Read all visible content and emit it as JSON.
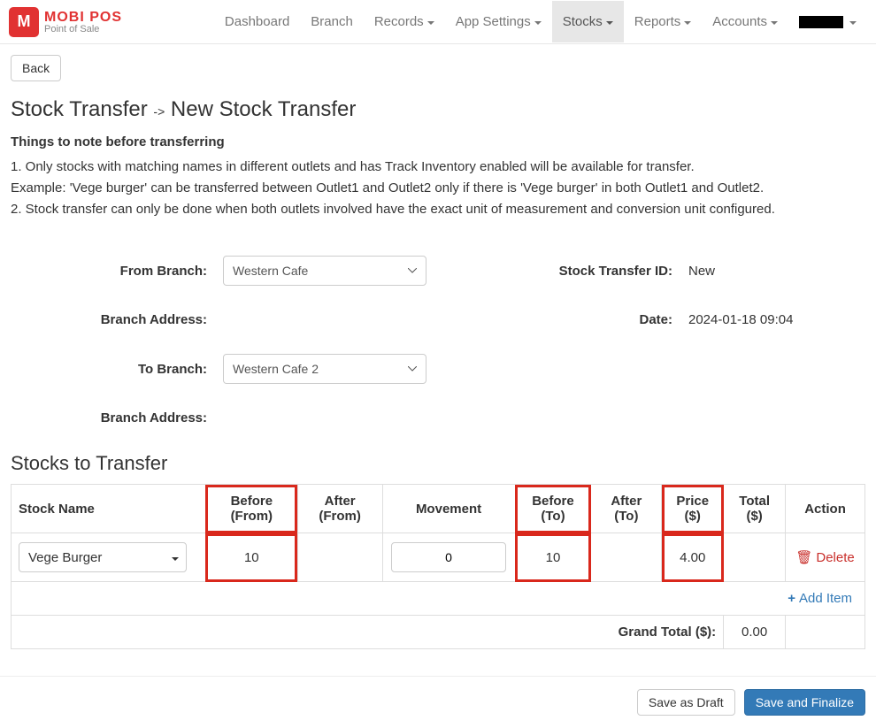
{
  "brand": {
    "name": "MOBI POS",
    "tagline": "Point of Sale",
    "logo_letter": "M"
  },
  "nav": {
    "items": [
      {
        "label": "Dashboard",
        "caret": false,
        "active": false
      },
      {
        "label": "Branch",
        "caret": false,
        "active": false
      },
      {
        "label": "Records",
        "caret": true,
        "active": false
      },
      {
        "label": "App Settings",
        "caret": true,
        "active": false
      },
      {
        "label": "Stocks",
        "caret": true,
        "active": true
      },
      {
        "label": "Reports",
        "caret": true,
        "active": false
      },
      {
        "label": "Accounts",
        "caret": true,
        "active": false
      }
    ]
  },
  "back_button": "Back",
  "title": {
    "crumb": "Stock Transfer",
    "arrow": "->",
    "page": "New Stock Transfer"
  },
  "notes": {
    "heading": "Things to note before transferring",
    "line1": "1. Only stocks with matching names in different outlets and has Track Inventory enabled will be available for transfer.",
    "line2": "Example: 'Vege burger' can be transferred between Outlet1 and Outlet2 only if there is 'Vege burger' in both Outlet1 and Outlet2.",
    "line3": "2. Stock transfer can only be done when both outlets involved have the exact unit of measurement and conversion unit configured."
  },
  "form": {
    "from_branch_label": "From Branch:",
    "from_branch_value": "Western Cafe",
    "branch_address_label": "Branch Address:",
    "branch_address_value": "",
    "to_branch_label": "To Branch:",
    "to_branch_value": "Western Cafe 2",
    "to_branch_address_value": "",
    "transfer_id_label": "Stock Transfer ID:",
    "transfer_id_value": "New",
    "date_label": "Date:",
    "date_value": "2024-01-18 09:04"
  },
  "section_heading": "Stocks to Transfer",
  "table": {
    "headers": {
      "stock_name": "Stock Name",
      "before_from": "Before (From)",
      "after_from": "After (From)",
      "movement": "Movement",
      "before_to": "Before (To)",
      "after_to": "After (To)",
      "price": "Price ($)",
      "total": "Total ($)",
      "action": "Action"
    },
    "rows": [
      {
        "stock_name": "Vege Burger",
        "before_from": "10",
        "after_from": "",
        "movement": "0",
        "before_to": "10",
        "after_to": "",
        "price": "4.00",
        "total": "",
        "delete_label": "Delete"
      }
    ],
    "add_item_label": "Add Item",
    "grand_total_label": "Grand Total ($):",
    "grand_total_value": "0.00"
  },
  "footer": {
    "save_draft": "Save as Draft",
    "save_finalize": "Save and Finalize"
  }
}
